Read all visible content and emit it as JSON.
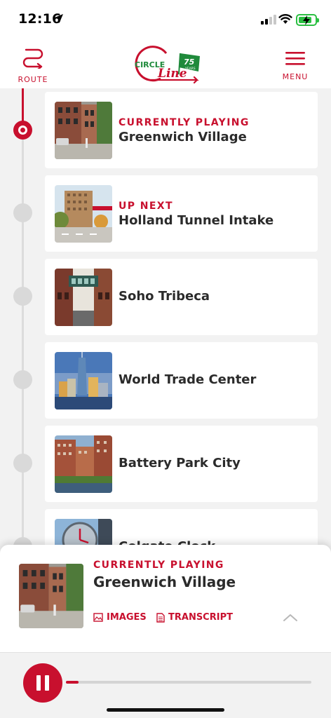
{
  "status_bar": {
    "time": "12:16"
  },
  "header": {
    "route_label": "ROUTE",
    "menu_label": "MENU",
    "logo_text_top": "CIRCLE",
    "logo_text_bottom": "Line",
    "logo_badge": "75",
    "logo_badge_sub": "YEARS"
  },
  "stops": [
    {
      "tag": "CURRENTLY PLAYING",
      "name": "Greenwich Village",
      "active": true
    },
    {
      "tag": "UP NEXT",
      "name": "Holland Tunnel Intake",
      "active": false
    },
    {
      "tag": "",
      "name": "Soho Tribeca",
      "active": false
    },
    {
      "tag": "",
      "name": "World Trade Center",
      "active": false
    },
    {
      "tag": "",
      "name": "Battery Park City",
      "active": false
    },
    {
      "tag": "",
      "name": "Colgate Clock",
      "active": false
    }
  ],
  "now_playing": {
    "tag": "CURRENTLY PLAYING",
    "title": "Greenwich Village",
    "images_label": "IMAGES",
    "transcript_label": "TRANSCRIPT"
  },
  "player": {
    "progress": 0.05
  },
  "colors": {
    "accent": "#c8102e",
    "timeline": "#dcdcdc",
    "background": "#f2f2f2"
  },
  "icons": {
    "route": "route-icon",
    "menu": "menu-icon",
    "images": "image-icon",
    "transcript": "document-icon",
    "expand": "chevron-up-icon",
    "pause": "pause-icon"
  }
}
